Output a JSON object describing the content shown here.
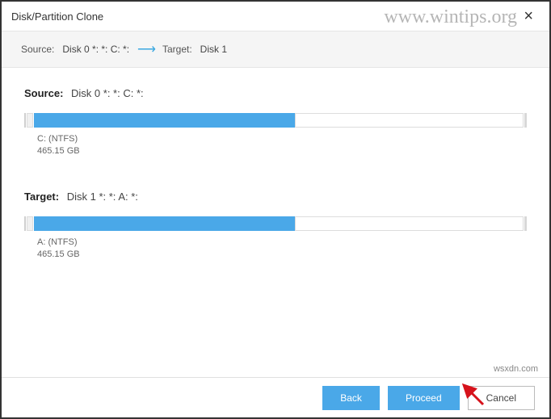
{
  "titlebar": {
    "title": "Disk/Partition Clone"
  },
  "summary": {
    "source_label": "Source:",
    "source_value": "Disk 0 *: *: C: *:",
    "target_label": "Target:",
    "target_value": "Disk 1"
  },
  "source": {
    "label": "Source:",
    "disk": "Disk 0 *: *: C: *:",
    "partition_name": "C: (NTFS)",
    "partition_size": "465.15 GB",
    "fill_percent": 52
  },
  "target": {
    "label": "Target:",
    "disk": "Disk 1 *: *: A: *:",
    "partition_name": "A: (NTFS)",
    "partition_size": "465.15 GB",
    "fill_percent": 52
  },
  "buttons": {
    "back": "Back",
    "proceed": "Proceed",
    "cancel": "Cancel"
  },
  "watermark": {
    "top": "www.wintips.org",
    "bottom": "wsxdn.com"
  }
}
